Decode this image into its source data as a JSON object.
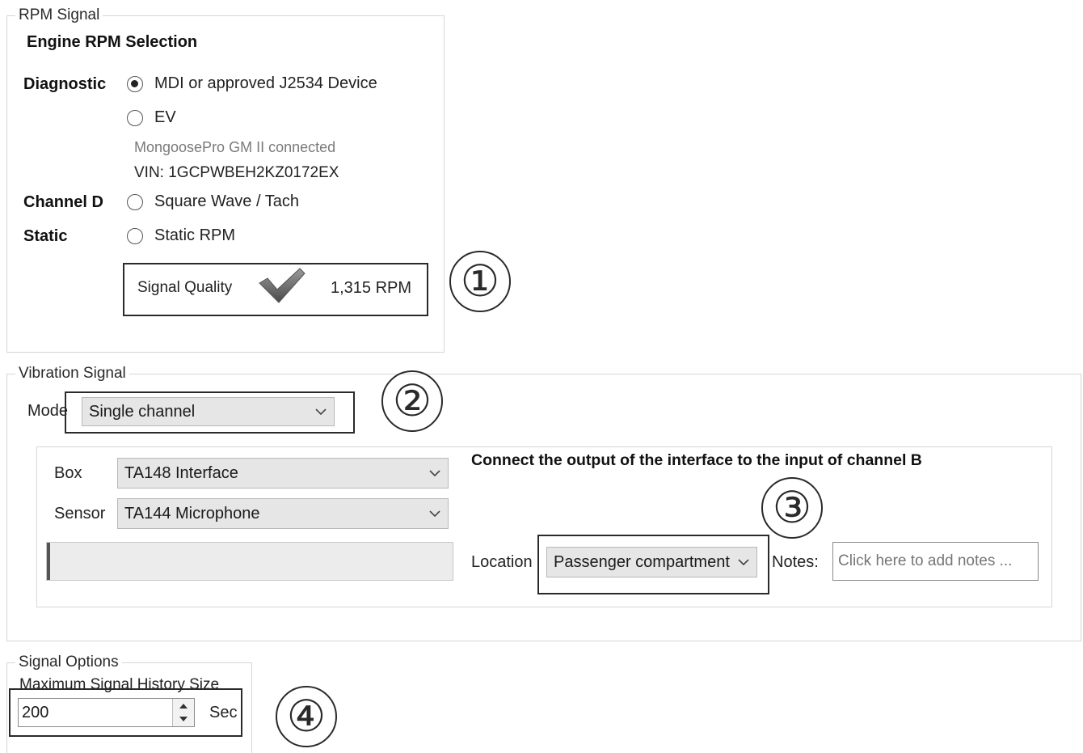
{
  "rpm": {
    "legend": "RPM Signal",
    "heading": "Engine RPM Selection",
    "diagnostic_label": "Diagnostic",
    "opt_mdi": "MDI or approved J2534 Device",
    "opt_ev": "EV",
    "device_status": "MongoosePro GM II connected",
    "vin": "VIN: 1GCPWBEH2KZ0172EX",
    "channel_label": "Channel D",
    "opt_square": "Square Wave / Tach",
    "static_label": "Static",
    "opt_static": "Static RPM",
    "quality_label": "Signal Quality",
    "rpm_value": "1,315 RPM",
    "selected_option": "MDI or approved J2534 Device",
    "check_icon": "checkmark-icon"
  },
  "vibration": {
    "legend": "Vibration Signal",
    "mode_label": "Mode",
    "mode_value": "Single channel",
    "box_label": "Box",
    "box_value": "TA148 Interface",
    "sensor_label": "Sensor",
    "sensor_value": "TA144 Microphone",
    "instruction": "Connect the output of the interface to the input of channel B",
    "location_label": "Location",
    "location_value": "Passenger compartment",
    "notes_label": "Notes:",
    "notes_placeholder": "Click here to add notes ..."
  },
  "signal_options": {
    "legend": "Signal Options",
    "history_label": "Maximum Signal History Size",
    "history_value": "200",
    "unit": "Sec"
  },
  "callouts": [
    "①",
    "②",
    "③",
    "④"
  ],
  "colors": {
    "highlight": "#2a2a2a",
    "combo_bg": "#e6e6e6",
    "group_border": "#d6d6d6"
  }
}
